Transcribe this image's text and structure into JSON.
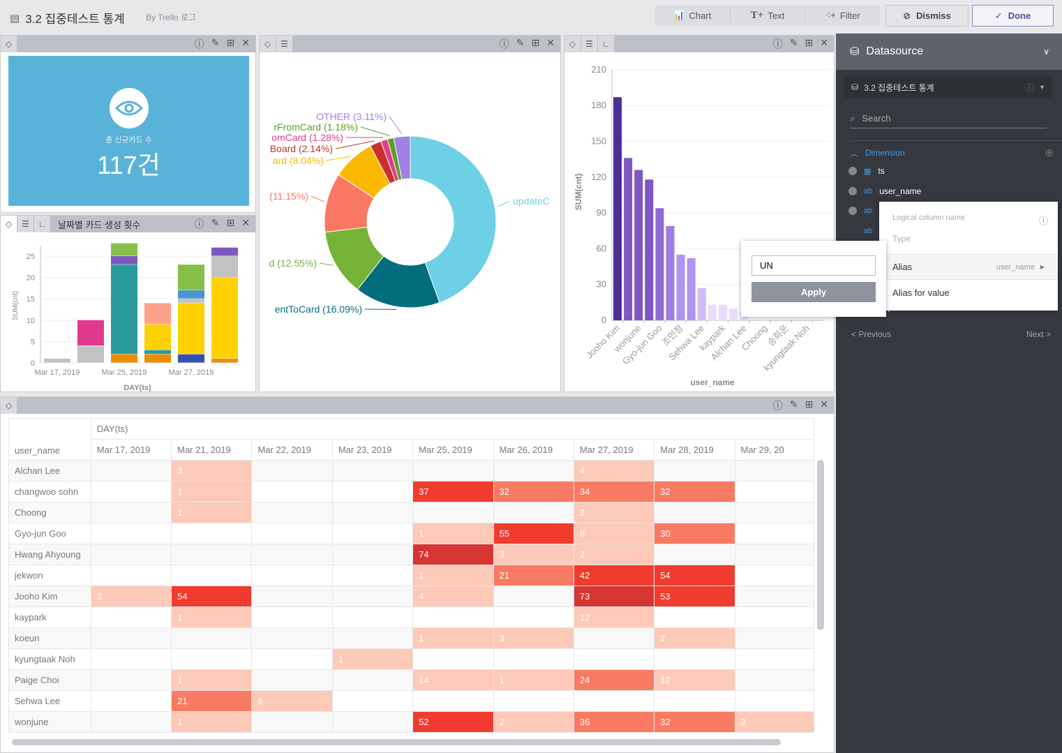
{
  "header": {
    "title": "3.2 집중테스트 통계",
    "subtitle": "By Trello 로그",
    "tools": [
      {
        "label": "Chart",
        "icon": "chart-add-icon"
      },
      {
        "label": "Text",
        "icon": "text-add-icon"
      },
      {
        "label": "Filter",
        "icon": "filter-add-icon"
      }
    ],
    "dismiss": "Dismiss",
    "done": "Done"
  },
  "kpi": {
    "label": "총 신규카드 수",
    "value": "117건",
    "icon": "eye-icon",
    "bg": "#59b3d9"
  },
  "stacked": {
    "title": "날짜별 카드 생성 횟수"
  },
  "sidebar": {
    "title": "Datasource",
    "datasource": "3.2 집중테스트 통계",
    "search_placeholder": "Search",
    "dimension": "Dimension",
    "fields": [
      {
        "type": "date",
        "name": "ts"
      },
      {
        "type": "ab",
        "name": "user_name"
      },
      {
        "type": "ab",
        "name": ""
      },
      {
        "type": "ab",
        "name": ""
      }
    ],
    "prev": "< Previous",
    "next": "Next >",
    "partial": "t"
  },
  "column_menu": {
    "logical": "Logical column name",
    "type": "Type",
    "alias": "Alias",
    "alias_value": "user_name",
    "alias_for_value": "Alias for value"
  },
  "alias_popup": {
    "value": "UN",
    "apply": "Apply"
  },
  "chart_data": [
    {
      "type": "bar",
      "stacked": true,
      "xlabel": "DAY(ts)",
      "ylabel": "SUM(cnt)",
      "ylim": [
        0,
        28
      ],
      "yticks": [
        0,
        5,
        10,
        15,
        20,
        25
      ],
      "categories": [
        "Mar 17, 2019",
        "",
        "Mar 25, 2019",
        "",
        "Mar 27, 2019",
        ""
      ],
      "stacks": [
        [
          {
            "v": 1,
            "c": "#c2c2c2"
          }
        ],
        [
          {
            "v": 4,
            "c": "#c2c2c2"
          },
          {
            "v": 6,
            "c": "#e0398d"
          }
        ],
        [
          {
            "v": 2,
            "c": "#f08c00"
          },
          {
            "v": 21,
            "c": "#2a9b9e"
          },
          {
            "v": 2,
            "c": "#7d58c2"
          },
          {
            "v": 3,
            "c": "#85bf46"
          }
        ],
        [
          {
            "v": 2,
            "c": "#f08c00"
          },
          {
            "v": 1,
            "c": "#2a9b9e"
          },
          {
            "v": 6,
            "c": "#fed200"
          },
          {
            "v": 5,
            "c": "#fda28a"
          }
        ],
        [
          {
            "v": 2,
            "c": "#3450b4"
          },
          {
            "v": 12,
            "c": "#fed200"
          },
          {
            "v": 1,
            "c": "#c2c2c2"
          },
          {
            "v": 2,
            "c": "#4a95d0"
          },
          {
            "v": 6,
            "c": "#85bf46"
          }
        ],
        [
          {
            "v": 1,
            "c": "#f08c00"
          },
          {
            "v": 19,
            "c": "#fed200"
          },
          {
            "v": 5,
            "c": "#c2c2c2"
          },
          {
            "v": 2,
            "c": "#7d58c2"
          }
        ]
      ]
    },
    {
      "type": "pie",
      "donut": true,
      "slices": [
        {
          "label": "updateC",
          "value": 44.46,
          "color": "#6dd0e5"
        },
        {
          "label": "entToCard (16.09%)",
          "value": 16.09,
          "color": "#036d7e"
        },
        {
          "label": "d (12.55%)",
          "value": 12.55,
          "color": "#74b336"
        },
        {
          "label": "(11.15%)",
          "value": 11.15,
          "color": "#fa7762"
        },
        {
          "label": "ard (8.04%)",
          "value": 8.04,
          "color": "#fbb800"
        },
        {
          "label": "Board (2.14%)",
          "value": 2.14,
          "color": "#c9302c"
        },
        {
          "label": "omCard (1.28%)",
          "value": 1.28,
          "color": "#e03c8a"
        },
        {
          "label": "rFromCard (1.18%)",
          "value": 1.18,
          "color": "#5c9e2e"
        },
        {
          "label": "OTHER (3.11%)",
          "value": 3.11,
          "color": "#9f80e3"
        }
      ]
    },
    {
      "type": "bar",
      "xlabel": "user_name",
      "ylabel": "SUM(cnt)",
      "ylim": [
        0,
        210
      ],
      "yticks": [
        0,
        30,
        60,
        90,
        120,
        150,
        180,
        210
      ],
      "categories": [
        "Jooho Kim",
        "",
        "wonjune",
        "",
        "Gyo-jun Goo",
        "",
        "조민정",
        "",
        "Sehwa Lee",
        "",
        "kaypark",
        "",
        "Alchan Lee",
        "",
        "Choong",
        "",
        "송희운",
        "",
        "kyungtaak Noh",
        ""
      ],
      "values": [
        187,
        136,
        126,
        118,
        94,
        79,
        55,
        52,
        27,
        13,
        13,
        10,
        7
      ],
      "colors": [
        "#4b2f96",
        "#7e58c0",
        "#7e58c0",
        "#7e58c0",
        "#8d6dd2",
        "#9c7fe0",
        "#ae95ee",
        "#ae95ee",
        "#d0bdf7",
        "#ecdcfb",
        "#ecdcfb",
        "#ecdcfb",
        "#ecdcfb"
      ]
    },
    {
      "type": "heatmap",
      "row_header": "user_name",
      "col_group": "DAY(ts)",
      "columns": [
        "Mar 17, 2019",
        "Mar 21, 2019",
        "Mar 22, 2019",
        "Mar 23, 2019",
        "Mar 25, 2019",
        "Mar 26, 2019",
        "Mar 27, 2019",
        "Mar 28, 2019",
        "Mar 29, 20"
      ],
      "rows": [
        {
          "name": "Alchan Lee",
          "values": [
            null,
            3,
            null,
            null,
            null,
            null,
            4,
            null,
            null
          ]
        },
        {
          "name": "changwoo sohn",
          "values": [
            null,
            1,
            null,
            null,
            37,
            32,
            34,
            32,
            null
          ]
        },
        {
          "name": "Choong",
          "values": [
            null,
            1,
            null,
            null,
            null,
            null,
            2,
            null,
            null
          ]
        },
        {
          "name": "Gyo-jun Goo",
          "values": [
            null,
            null,
            null,
            null,
            1,
            55,
            8,
            30,
            null
          ]
        },
        {
          "name": "Hwang Ahyoung",
          "values": [
            null,
            null,
            null,
            null,
            74,
            3,
            2,
            null,
            null
          ]
        },
        {
          "name": "jekwon",
          "values": [
            null,
            null,
            null,
            null,
            1,
            21,
            42,
            54,
            null
          ]
        },
        {
          "name": "Jooho Kim",
          "values": [
            3,
            54,
            null,
            null,
            4,
            null,
            73,
            53,
            null
          ]
        },
        {
          "name": "kaypark",
          "values": [
            null,
            1,
            null,
            null,
            null,
            null,
            12,
            null,
            null
          ]
        },
        {
          "name": "koeun",
          "values": [
            null,
            null,
            null,
            null,
            1,
            3,
            null,
            2,
            null
          ]
        },
        {
          "name": "kyungtaak Noh",
          "values": [
            null,
            null,
            null,
            1,
            null,
            null,
            null,
            null,
            null
          ]
        },
        {
          "name": "Paige Choi",
          "values": [
            null,
            1,
            null,
            null,
            14,
            1,
            24,
            12,
            null
          ]
        },
        {
          "name": "Sehwa Lee",
          "values": [
            null,
            21,
            6,
            null,
            null,
            null,
            null,
            null,
            null
          ]
        },
        {
          "name": "wonjune",
          "values": [
            null,
            1,
            null,
            null,
            52,
            2,
            36,
            32,
            3
          ]
        }
      ],
      "scale_colors": [
        "#fdc9b9",
        "#f97a62",
        "#f03b2e",
        "#d63532"
      ]
    }
  ]
}
